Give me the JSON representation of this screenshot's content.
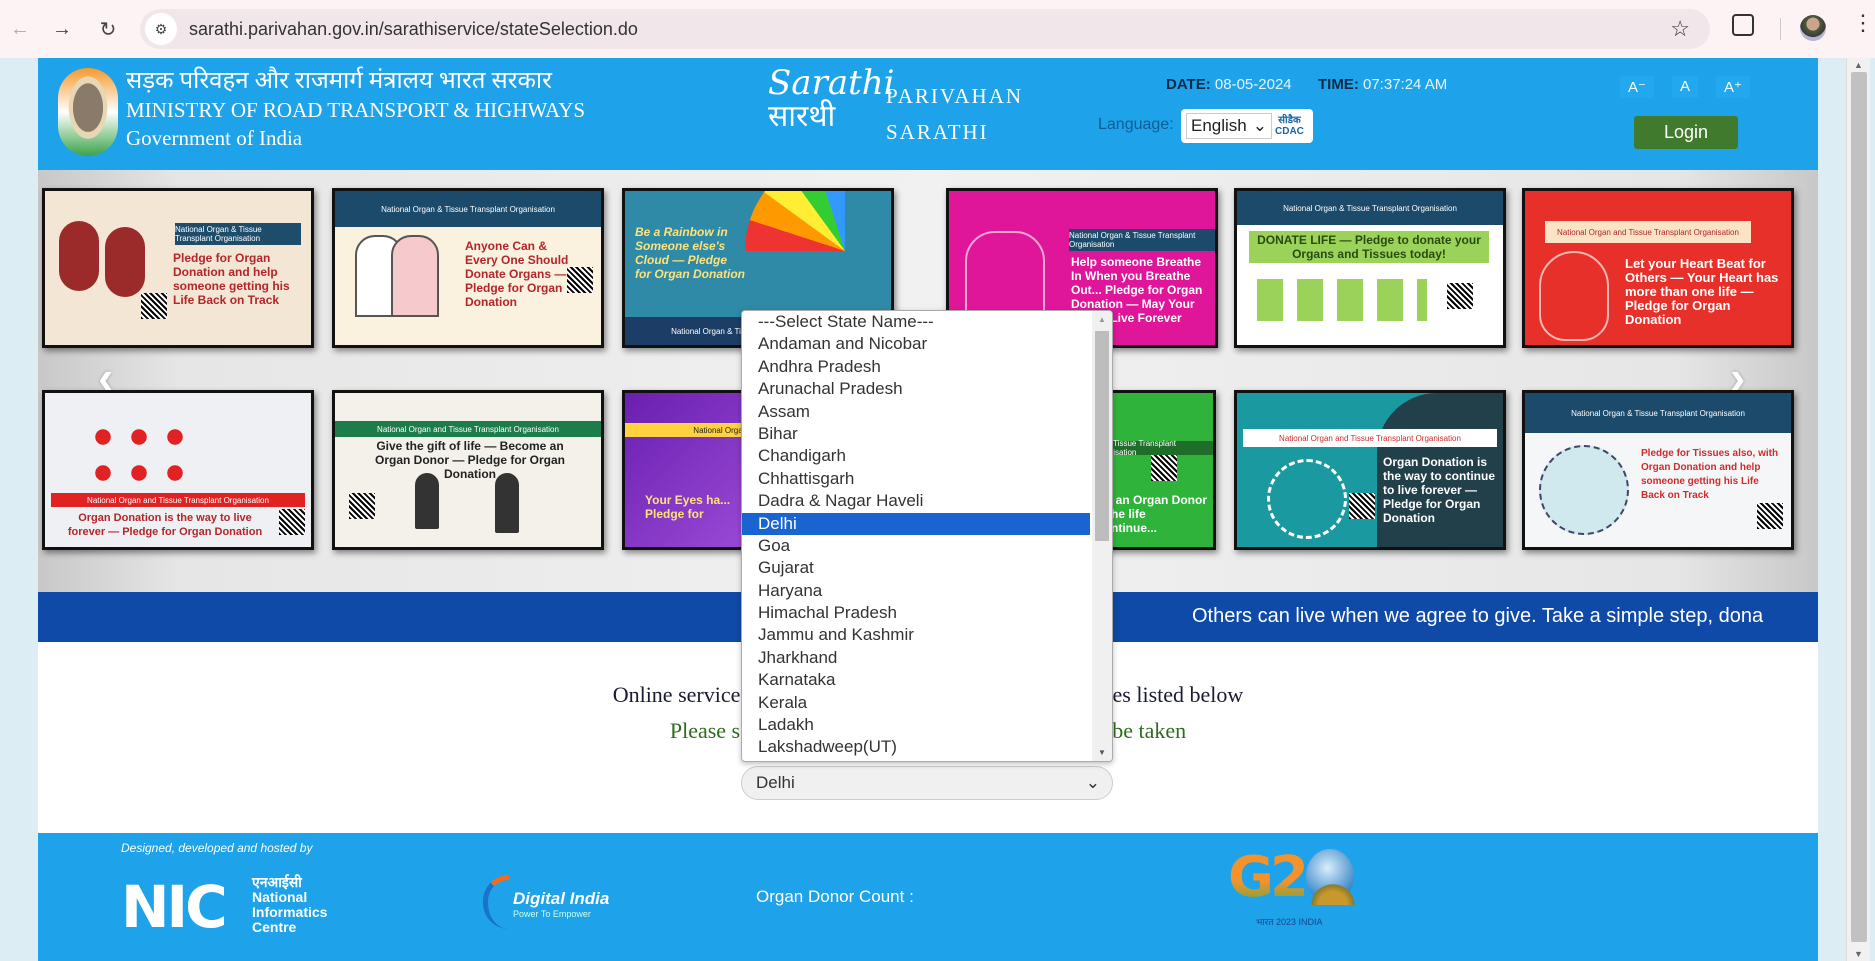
{
  "browser": {
    "url": "sarathi.parivahan.gov.in/sarathiservice/stateSelection.do",
    "icons": [
      "back-arrow-icon",
      "forward-arrow-icon",
      "reload-icon",
      "site-info-icon",
      "bookmark-star-icon",
      "extensions-icon",
      "profile-avatar",
      "more-menu-icon"
    ]
  },
  "header": {
    "ministry_hindi": "सड़क परिवहन और राजमार्ग मंत्रालय भारत सरकार",
    "ministry_english": "MINISTRY OF ROAD TRANSPORT & HIGHWAYS",
    "government": "Government of India",
    "logo_line1": "Sarathi",
    "logo_line2": "सारथी",
    "brand_line1": "PARIVAHAN",
    "brand_line2": "SARATHI",
    "date_label": "DATE",
    "date_value": "08-05-2024",
    "time_label": "TIME",
    "time_value": "07:37:24 AM",
    "language_label": "Language:",
    "language_value": "English",
    "cdac_hindi": "सीडैक",
    "cdac_english": "CDAC",
    "font_decrease": "A⁻",
    "font_normal": "A",
    "font_increase": "A⁺",
    "login_label": "Login"
  },
  "carousel": {
    "top_row": [
      {
        "header": "National Organ & Tissue Transplant Organisation",
        "title": "Pledge for Organ Donation and help someone getting his Life Back on Track"
      },
      {
        "header": "National Organ & Tissue Transplant Organisation",
        "title": "Anyone Can & Every One Should Donate Organs — Pledge for Organ Donation"
      },
      {
        "header": "National Organ & Tissue Transplant Organisation",
        "title": "Be a Rainbow in Someone else's Cloud — Pledge for Organ Donation"
      },
      {
        "header": "National Organ & Tissue Transplant Organisation",
        "title": "Help someone Breathe In When you Breathe Out... Pledge for Organ Donation — May Your Lungs Live Forever"
      },
      {
        "header": "National Organ & Tissue Transplant Organisation",
        "title": "DONATE LIFE — Pledge to donate your Organs and Tissues today!"
      },
      {
        "header": "National Organ and Tissue Transplant Organisation",
        "title": "Let your Heart Beat for Others — Your Heart has more than one life — Pledge for Organ Donation"
      }
    ],
    "bottom_row": [
      {
        "header": "National Organ and Tissue Transplant Organisation",
        "title": "Organ Donation is the way to live forever — Pledge for Organ Donation"
      },
      {
        "header": "National Organ and Tissue Transplant Organisation",
        "title": "Give the gift of life — Become an Organ Donor — Pledge for Organ Donation"
      },
      {
        "header": "National Organ and",
        "title": "Your Eyes ha... Pledge for"
      },
      {
        "header": "...and Tissue Transplant Organisation",
        "title": "Be an Organ Donor ...the life continue..."
      },
      {
        "header": "National Organ and Tissue Transplant Organisation",
        "title": "Organ Donation is the way to continue to live forever — Pledge for Organ Donation"
      },
      {
        "header": "National Organ & Tissue Transplant Organisation",
        "title": "Pledge for Tissues also, with Organ Donation and help someone getting his Life Back on Track"
      }
    ],
    "prev_icon": "chevron-left-icon",
    "next_icon": "chevron-right-icon"
  },
  "ticker": {
    "text": "Others can live when we agree to give. Take a simple step, dona"
  },
  "main": {
    "info_line1_left": "Online services i",
    "info_line1_right": "tates listed below",
    "info_line2_left": "Please sele",
    "info_line2_right": "o be taken",
    "selected_state": "Delhi"
  },
  "dropdown": {
    "options": [
      "---Select State Name---",
      "Andaman and Nicobar",
      "Andhra Pradesh",
      "Arunachal Pradesh",
      "Assam",
      "Bihar",
      "Chandigarh",
      "Chhattisgarh",
      "Dadra & Nagar Haveli",
      "Delhi",
      "Goa",
      "Gujarat",
      "Haryana",
      "Himachal Pradesh",
      "Jammu and Kashmir",
      "Jharkhand",
      "Karnataka",
      "Kerala",
      "Ladakh",
      "Lakshadweep(UT)"
    ],
    "highlighted": "Delhi"
  },
  "footer": {
    "designed_by": "Designed, developed and hosted by",
    "nic_short": "NIC",
    "nic_hindi": "एनआईसी",
    "nic_line1": "National",
    "nic_line2": "Informatics",
    "nic_line3": "Centre",
    "digital_india": "Digital India",
    "digital_india_tagline": "Power To Empower",
    "organ_donor_label": "Organ Donor Count :",
    "g20_text": "G20",
    "g20_sub": "भारत 2023 INDIA"
  },
  "colors": {
    "header_blue": "#1ea3ea",
    "ticker_blue": "#0f4aa8",
    "login_green": "#3f7a2d",
    "dropdown_highlight": "#1a64d2",
    "info_green": "#2f6b1e"
  }
}
